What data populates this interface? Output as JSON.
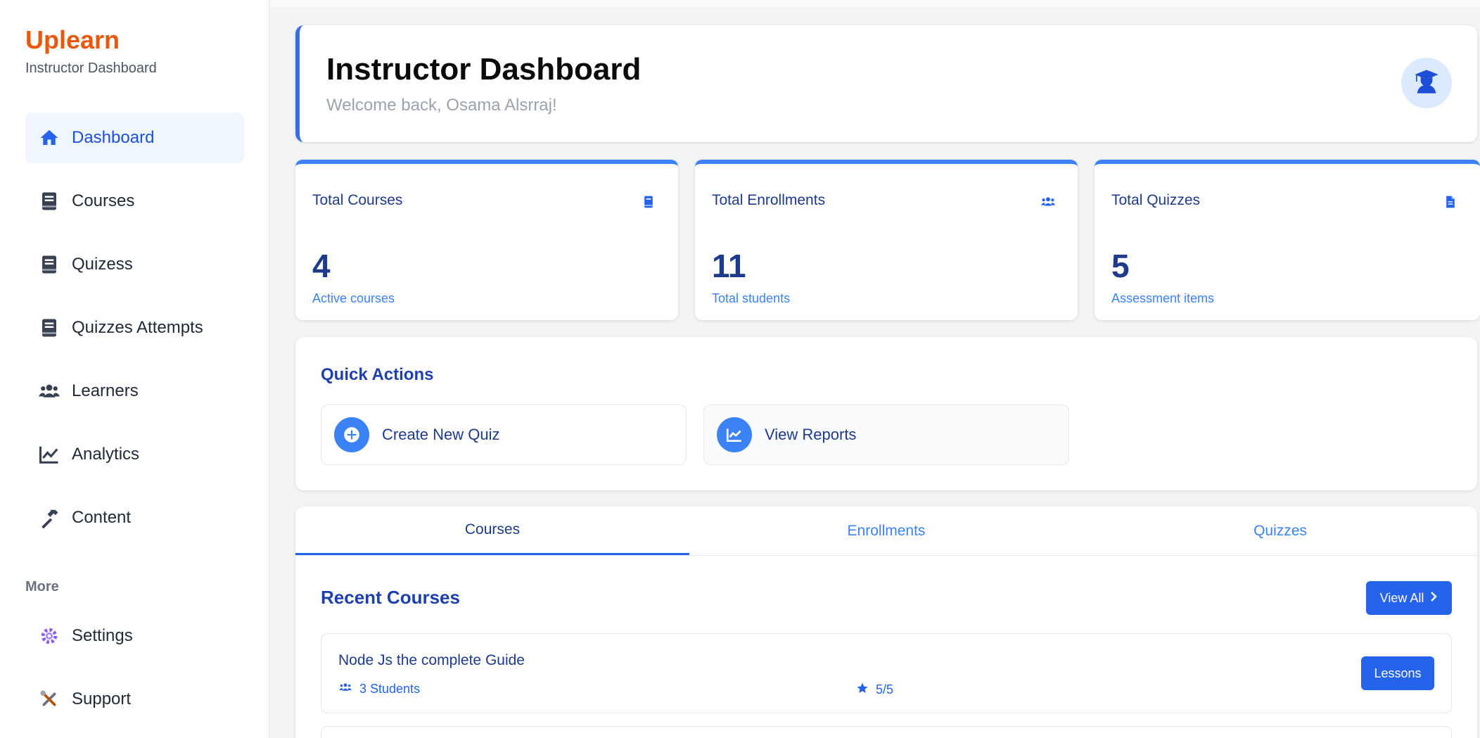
{
  "sidebar": {
    "brand": "Uplearn",
    "subtitle": "Instructor Dashboard",
    "items": [
      {
        "label": "Dashboard",
        "icon": "home-icon"
      },
      {
        "label": "Courses",
        "icon": "book-icon"
      },
      {
        "label": "Quizess",
        "icon": "book-icon"
      },
      {
        "label": "Quizzes Attempts",
        "icon": "book-icon"
      },
      {
        "label": "Learners",
        "icon": "users-icon"
      },
      {
        "label": "Analytics",
        "icon": "chart-line-icon"
      },
      {
        "label": "Content",
        "icon": "hammer-icon"
      }
    ],
    "more_label": "More",
    "more_items": [
      {
        "label": "Settings",
        "icon": "gear-icon"
      },
      {
        "label": "Support",
        "icon": "tools-icon"
      }
    ]
  },
  "header": {
    "title": "Instructor Dashboard",
    "welcome": "Welcome back, Osama Alsrraj!"
  },
  "stats": [
    {
      "title": "Total Courses",
      "value": "4",
      "subtitle": "Active courses",
      "icon": "book-icon"
    },
    {
      "title": "Total Enrollments",
      "value": "11",
      "subtitle": "Total students",
      "icon": "users-icon"
    },
    {
      "title": "Total Quizzes",
      "value": "5",
      "subtitle": "Assessment items",
      "icon": "file-icon"
    }
  ],
  "quick_actions": {
    "title": "Quick Actions",
    "buttons": [
      {
        "label": "Create New Quiz",
        "icon": "plus-circle-icon"
      },
      {
        "label": "View Reports",
        "icon": "chart-line-icon"
      }
    ]
  },
  "tabs": [
    "Courses",
    "Enrollments",
    "Quizzes"
  ],
  "recent_courses": {
    "title": "Recent Courses",
    "view_all_label": "View All",
    "items": [
      {
        "name": "Node Js the complete Guide",
        "students": "3 Students",
        "rating": "5/5",
        "action": "Lessons"
      }
    ]
  },
  "colors": {
    "brand": "#ea580c",
    "accent": "#2563eb",
    "heading": "#1e3a8a"
  }
}
